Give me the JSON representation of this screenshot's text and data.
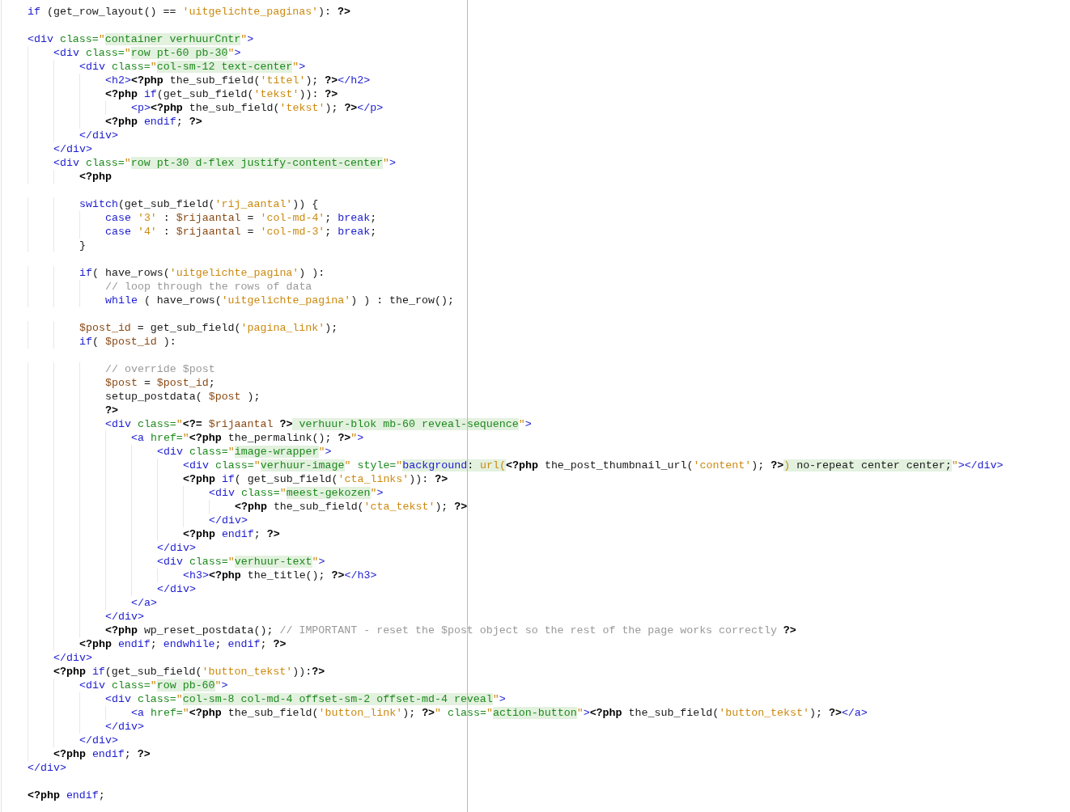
{
  "editor": {
    "lines": [
      {
        "tokens": [
          {
            "kind": "keyword",
            "text": "if"
          },
          {
            "kind": "plain",
            "text": " (get_row_layout() == "
          },
          {
            "kind": "string",
            "text": "'uitgelichte_paginas'"
          },
          {
            "kind": "plain",
            "text": "): "
          },
          {
            "kind": "php",
            "text": "?>"
          }
        ]
      },
      {
        "kind": "blank"
      },
      {
        "tokens": [
          {
            "kind": "tag",
            "text": "<div"
          },
          {
            "kind": "attr",
            "text": " class="
          },
          {
            "kind": "quote",
            "text": "\""
          },
          {
            "kind": "value",
            "text": "container verhuurCntr"
          },
          {
            "kind": "quote",
            "text": "\""
          },
          {
            "kind": "tag",
            "text": ">"
          }
        ]
      },
      {
        "tokens": [
          {
            "kind": "tag",
            "text": "    <div"
          },
          {
            "kind": "attr",
            "text": " class="
          },
          {
            "kind": "quote",
            "text": "\""
          },
          {
            "kind": "value",
            "text": "row pt-60 pb-30"
          },
          {
            "kind": "quote",
            "text": "\""
          },
          {
            "kind": "tag",
            "text": ">"
          }
        ]
      },
      {
        "tokens": [
          {
            "kind": "tag",
            "text": "        <div"
          },
          {
            "kind": "attr",
            "text": " class="
          },
          {
            "kind": "quote",
            "text": "\""
          },
          {
            "kind": "value",
            "text": "col-sm-12 text-center"
          },
          {
            "kind": "quote",
            "text": "\""
          },
          {
            "kind": "tag",
            "text": ">"
          }
        ]
      },
      {
        "tokens": [
          {
            "kind": "tag",
            "text": "            <h2>"
          },
          {
            "kind": "php",
            "text": "<?php"
          },
          {
            "kind": "plain",
            "text": " the_sub_field("
          },
          {
            "kind": "string",
            "text": "'titel'"
          },
          {
            "kind": "plain",
            "text": "); "
          },
          {
            "kind": "php",
            "text": "?>"
          },
          {
            "kind": "tag",
            "text": "</h2>"
          }
        ]
      },
      {
        "tokens": [
          {
            "kind": "php",
            "text": "            <?php"
          },
          {
            "kind": "keyword",
            "text": " if"
          },
          {
            "kind": "plain",
            "text": "(get_sub_field("
          },
          {
            "kind": "string",
            "text": "'tekst'"
          },
          {
            "kind": "plain",
            "text": ")): "
          },
          {
            "kind": "php",
            "text": "?>"
          }
        ]
      },
      {
        "tokens": [
          {
            "kind": "tag",
            "text": "                <p>"
          },
          {
            "kind": "php",
            "text": "<?php"
          },
          {
            "kind": "plain",
            "text": " the_sub_field("
          },
          {
            "kind": "string",
            "text": "'tekst'"
          },
          {
            "kind": "plain",
            "text": "); "
          },
          {
            "kind": "php",
            "text": "?>"
          },
          {
            "kind": "tag",
            "text": "</p>"
          }
        ]
      },
      {
        "tokens": [
          {
            "kind": "php",
            "text": "            <?php"
          },
          {
            "kind": "keyword",
            "text": " endif"
          },
          {
            "kind": "plain",
            "text": "; "
          },
          {
            "kind": "php",
            "text": "?>"
          }
        ]
      },
      {
        "tokens": [
          {
            "kind": "tag",
            "text": "        </div>"
          }
        ]
      },
      {
        "tokens": [
          {
            "kind": "tag",
            "text": "    </div>"
          }
        ]
      },
      {
        "tokens": [
          {
            "kind": "tag",
            "text": "    <div"
          },
          {
            "kind": "attr",
            "text": " class="
          },
          {
            "kind": "quote",
            "text": "\""
          },
          {
            "kind": "value",
            "text": "row pt-30 d-flex justify-content-center"
          },
          {
            "kind": "quote",
            "text": "\""
          },
          {
            "kind": "tag",
            "text": ">"
          }
        ]
      },
      {
        "tokens": [
          {
            "kind": "php",
            "text": "        <?php"
          }
        ]
      },
      {
        "kind": "blank"
      },
      {
        "tokens": [
          {
            "kind": "keyword",
            "text": "        switch"
          },
          {
            "kind": "plain",
            "text": "(get_sub_field("
          },
          {
            "kind": "string",
            "text": "'rij_aantal'"
          },
          {
            "kind": "plain",
            "text": ")) {"
          }
        ]
      },
      {
        "tokens": [
          {
            "kind": "keyword",
            "text": "            case"
          },
          {
            "kind": "string",
            "text": " '3'"
          },
          {
            "kind": "plain",
            "text": " : "
          },
          {
            "kind": "variable",
            "text": "$rijaantal"
          },
          {
            "kind": "plain",
            "text": " = "
          },
          {
            "kind": "string",
            "text": "'col-md-4'"
          },
          {
            "kind": "plain",
            "text": "; "
          },
          {
            "kind": "keyword",
            "text": "break"
          },
          {
            "kind": "plain",
            "text": ";"
          }
        ]
      },
      {
        "tokens": [
          {
            "kind": "keyword",
            "text": "            case"
          },
          {
            "kind": "string",
            "text": " '4'"
          },
          {
            "kind": "plain",
            "text": " : "
          },
          {
            "kind": "variable",
            "text": "$rijaantal"
          },
          {
            "kind": "plain",
            "text": " = "
          },
          {
            "kind": "string",
            "text": "'col-md-3'"
          },
          {
            "kind": "plain",
            "text": "; "
          },
          {
            "kind": "keyword",
            "text": "break"
          },
          {
            "kind": "plain",
            "text": ";"
          }
        ]
      },
      {
        "tokens": [
          {
            "kind": "plain",
            "text": "        }"
          }
        ]
      },
      {
        "kind": "blank"
      },
      {
        "tokens": [
          {
            "kind": "keyword",
            "text": "        if"
          },
          {
            "kind": "plain",
            "text": "( have_rows("
          },
          {
            "kind": "string",
            "text": "'uitgelichte_pagina'"
          },
          {
            "kind": "plain",
            "text": ") ):"
          }
        ]
      },
      {
        "tokens": [
          {
            "kind": "comment",
            "text": "            // loop through the rows of data"
          }
        ]
      },
      {
        "tokens": [
          {
            "kind": "keyword",
            "text": "            while"
          },
          {
            "kind": "plain",
            "text": " ( have_rows("
          },
          {
            "kind": "string",
            "text": "'uitgelichte_pagina'"
          },
          {
            "kind": "plain",
            "text": ") ) : the_row();"
          }
        ]
      },
      {
        "kind": "blank"
      },
      {
        "tokens": [
          {
            "kind": "variable",
            "text": "        $post_id"
          },
          {
            "kind": "plain",
            "text": " = get_sub_field("
          },
          {
            "kind": "string",
            "text": "'pagina_link'"
          },
          {
            "kind": "plain",
            "text": ");"
          }
        ]
      },
      {
        "tokens": [
          {
            "kind": "keyword",
            "text": "        if"
          },
          {
            "kind": "plain",
            "text": "( "
          },
          {
            "kind": "variable",
            "text": "$post_id"
          },
          {
            "kind": "plain",
            "text": " ):"
          }
        ]
      },
      {
        "kind": "blank"
      },
      {
        "tokens": [
          {
            "kind": "comment",
            "text": "            // override $post"
          }
        ]
      },
      {
        "tokens": [
          {
            "kind": "variable",
            "text": "            $post"
          },
          {
            "kind": "plain",
            "text": " = "
          },
          {
            "kind": "variable",
            "text": "$post_id"
          },
          {
            "kind": "plain",
            "text": ";"
          }
        ]
      },
      {
        "tokens": [
          {
            "kind": "plain",
            "text": "            setup_postdata( "
          },
          {
            "kind": "variable",
            "text": "$post"
          },
          {
            "kind": "plain",
            "text": " );"
          }
        ]
      },
      {
        "tokens": [
          {
            "kind": "php",
            "text": "            ?>"
          }
        ]
      },
      {
        "tokens": [
          {
            "kind": "tag",
            "text": "            <div"
          },
          {
            "kind": "attr",
            "text": " class="
          },
          {
            "kind": "quote",
            "text": "\""
          },
          {
            "kind": "php",
            "text": "<?="
          },
          {
            "kind": "variable",
            "text": " $rijaantal"
          },
          {
            "kind": "php",
            "text": " ?>"
          },
          {
            "kind": "value",
            "text": " verhuur-blok mb-60 reveal-sequence"
          },
          {
            "kind": "quote",
            "text": "\""
          },
          {
            "kind": "tag",
            "text": ">"
          }
        ]
      },
      {
        "tokens": [
          {
            "kind": "tag",
            "text": "                <a"
          },
          {
            "kind": "attr",
            "text": " href="
          },
          {
            "kind": "quote",
            "text": "\""
          },
          {
            "kind": "php",
            "text": "<?php"
          },
          {
            "kind": "plain",
            "text": " the_permalink(); "
          },
          {
            "kind": "php",
            "text": "?>"
          },
          {
            "kind": "quote",
            "text": "\""
          },
          {
            "kind": "tag",
            "text": ">"
          }
        ]
      },
      {
        "tokens": [
          {
            "kind": "tag",
            "text": "                    <div"
          },
          {
            "kind": "attr",
            "text": " class="
          },
          {
            "kind": "quote",
            "text": "\""
          },
          {
            "kind": "value",
            "text": "image-wrapper"
          },
          {
            "kind": "quote",
            "text": "\""
          },
          {
            "kind": "tag",
            "text": ">"
          }
        ]
      },
      {
        "tokens": [
          {
            "kind": "tag",
            "text": "                        <div"
          },
          {
            "kind": "attr",
            "text": " class="
          },
          {
            "kind": "quote",
            "text": "\""
          },
          {
            "kind": "value",
            "text": "verhuur-image"
          },
          {
            "kind": "quote",
            "text": "\""
          },
          {
            "kind": "attr",
            "text": " style="
          },
          {
            "kind": "quote",
            "text": "\""
          },
          {
            "kind": "css-prop",
            "text": "background"
          },
          {
            "kind": "css-text",
            "text": ": "
          },
          {
            "kind": "css-fn",
            "text": "url("
          },
          {
            "kind": "php",
            "text": "<?php"
          },
          {
            "kind": "plain",
            "text": " the_post_thumbnail_url("
          },
          {
            "kind": "string",
            "text": "'content'"
          },
          {
            "kind": "plain",
            "text": "); "
          },
          {
            "kind": "php",
            "text": "?>"
          },
          {
            "kind": "css-fn",
            "text": ")"
          },
          {
            "kind": "css-text",
            "text": " no-repeat center center;"
          },
          {
            "kind": "quote",
            "text": "\""
          },
          {
            "kind": "tag",
            "text": "></div>"
          }
        ]
      },
      {
        "tokens": [
          {
            "kind": "php",
            "text": "                        <?php"
          },
          {
            "kind": "keyword",
            "text": " if"
          },
          {
            "kind": "plain",
            "text": "( get_sub_field("
          },
          {
            "kind": "string",
            "text": "'cta_links'"
          },
          {
            "kind": "plain",
            "text": ")): "
          },
          {
            "kind": "php",
            "text": "?>"
          }
        ]
      },
      {
        "tokens": [
          {
            "kind": "tag",
            "text": "                            <div"
          },
          {
            "kind": "attr",
            "text": " class="
          },
          {
            "kind": "quote",
            "text": "\""
          },
          {
            "kind": "value",
            "text": "meest-gekozen"
          },
          {
            "kind": "quote",
            "text": "\""
          },
          {
            "kind": "tag",
            "text": ">"
          }
        ]
      },
      {
        "tokens": [
          {
            "kind": "php",
            "text": "                                <?php"
          },
          {
            "kind": "plain",
            "text": " the_sub_field("
          },
          {
            "kind": "string",
            "text": "'cta_tekst'"
          },
          {
            "kind": "plain",
            "text": "); "
          },
          {
            "kind": "php",
            "text": "?>"
          }
        ]
      },
      {
        "tokens": [
          {
            "kind": "tag",
            "text": "                            </div>"
          }
        ]
      },
      {
        "tokens": [
          {
            "kind": "php",
            "text": "                        <?php"
          },
          {
            "kind": "keyword",
            "text": " endif"
          },
          {
            "kind": "plain",
            "text": "; "
          },
          {
            "kind": "php",
            "text": "?>"
          }
        ]
      },
      {
        "tokens": [
          {
            "kind": "tag",
            "text": "                    </div>"
          }
        ]
      },
      {
        "tokens": [
          {
            "kind": "tag",
            "text": "                    <div"
          },
          {
            "kind": "attr",
            "text": " class="
          },
          {
            "kind": "quote",
            "text": "\""
          },
          {
            "kind": "value",
            "text": "verhuur-text"
          },
          {
            "kind": "quote",
            "text": "\""
          },
          {
            "kind": "tag",
            "text": ">"
          }
        ]
      },
      {
        "tokens": [
          {
            "kind": "tag",
            "text": "                        <h3>"
          },
          {
            "kind": "php",
            "text": "<?php"
          },
          {
            "kind": "plain",
            "text": " the_title(); "
          },
          {
            "kind": "php",
            "text": "?>"
          },
          {
            "kind": "tag",
            "text": "</h3>"
          }
        ]
      },
      {
        "tokens": [
          {
            "kind": "tag",
            "text": "                    </div>"
          }
        ]
      },
      {
        "tokens": [
          {
            "kind": "tag",
            "text": "                </a>"
          }
        ]
      },
      {
        "tokens": [
          {
            "kind": "tag",
            "text": "            </div>"
          }
        ]
      },
      {
        "tokens": [
          {
            "kind": "php",
            "text": "            <?php"
          },
          {
            "kind": "plain",
            "text": " wp_reset_postdata(); "
          },
          {
            "kind": "comment",
            "text": "// IMPORTANT - reset the $post object so the rest of the page works correctly"
          },
          {
            "kind": "php",
            "text": " ?>"
          }
        ]
      },
      {
        "tokens": [
          {
            "kind": "php",
            "text": "        <?php"
          },
          {
            "kind": "keyword",
            "text": " endif"
          },
          {
            "kind": "plain",
            "text": "; "
          },
          {
            "kind": "keyword",
            "text": "endwhile"
          },
          {
            "kind": "plain",
            "text": "; "
          },
          {
            "kind": "keyword",
            "text": "endif"
          },
          {
            "kind": "plain",
            "text": "; "
          },
          {
            "kind": "php",
            "text": "?>"
          }
        ]
      },
      {
        "tokens": [
          {
            "kind": "tag",
            "text": "    </div>"
          }
        ]
      },
      {
        "tokens": [
          {
            "kind": "php",
            "text": "    <?php"
          },
          {
            "kind": "keyword",
            "text": " if"
          },
          {
            "kind": "plain",
            "text": "(get_sub_field("
          },
          {
            "kind": "string",
            "text": "'button_tekst'"
          },
          {
            "kind": "plain",
            "text": ")):"
          },
          {
            "kind": "php",
            "text": "?>"
          }
        ]
      },
      {
        "tokens": [
          {
            "kind": "tag",
            "text": "        <div"
          },
          {
            "kind": "attr",
            "text": " class="
          },
          {
            "kind": "quote",
            "text": "\""
          },
          {
            "kind": "value",
            "text": "row pb-60"
          },
          {
            "kind": "quote",
            "text": "\""
          },
          {
            "kind": "tag",
            "text": ">"
          }
        ]
      },
      {
        "tokens": [
          {
            "kind": "tag",
            "text": "            <div"
          },
          {
            "kind": "attr",
            "text": " class="
          },
          {
            "kind": "quote",
            "text": "\""
          },
          {
            "kind": "value",
            "text": "col-sm-8 col-md-4 offset-sm-2 offset-md-4 reveal"
          },
          {
            "kind": "quote",
            "text": "\""
          },
          {
            "kind": "tag",
            "text": ">"
          }
        ]
      },
      {
        "tokens": [
          {
            "kind": "tag",
            "text": "                <a"
          },
          {
            "kind": "attr",
            "text": " href="
          },
          {
            "kind": "quote",
            "text": "\""
          },
          {
            "kind": "php",
            "text": "<?php"
          },
          {
            "kind": "plain",
            "text": " the_sub_field("
          },
          {
            "kind": "string",
            "text": "'button_link'"
          },
          {
            "kind": "plain",
            "text": "); "
          },
          {
            "kind": "php",
            "text": "?>"
          },
          {
            "kind": "quote",
            "text": "\""
          },
          {
            "kind": "attr",
            "text": " class="
          },
          {
            "kind": "quote",
            "text": "\""
          },
          {
            "kind": "value",
            "text": "action-button"
          },
          {
            "kind": "quote",
            "text": "\""
          },
          {
            "kind": "tag",
            "text": ">"
          },
          {
            "kind": "php",
            "text": "<?php"
          },
          {
            "kind": "plain",
            "text": " the_sub_field("
          },
          {
            "kind": "string",
            "text": "'button_tekst'"
          },
          {
            "kind": "plain",
            "text": "); "
          },
          {
            "kind": "php",
            "text": "?>"
          },
          {
            "kind": "tag",
            "text": "</a>"
          }
        ]
      },
      {
        "tokens": [
          {
            "kind": "tag",
            "text": "            </div>"
          }
        ]
      },
      {
        "tokens": [
          {
            "kind": "tag",
            "text": "        </div>"
          }
        ]
      },
      {
        "tokens": [
          {
            "kind": "php",
            "text": "    <?php"
          },
          {
            "kind": "keyword",
            "text": " endif"
          },
          {
            "kind": "plain",
            "text": "; "
          },
          {
            "kind": "php",
            "text": "?>"
          }
        ]
      },
      {
        "tokens": [
          {
            "kind": "tag",
            "text": "</div>"
          }
        ]
      },
      {
        "kind": "blank"
      },
      {
        "tokens": [
          {
            "kind": "php",
            "text": "<?php"
          },
          {
            "kind": "keyword",
            "text": " endif"
          },
          {
            "kind": "plain",
            "text": ";"
          }
        ]
      }
    ]
  }
}
